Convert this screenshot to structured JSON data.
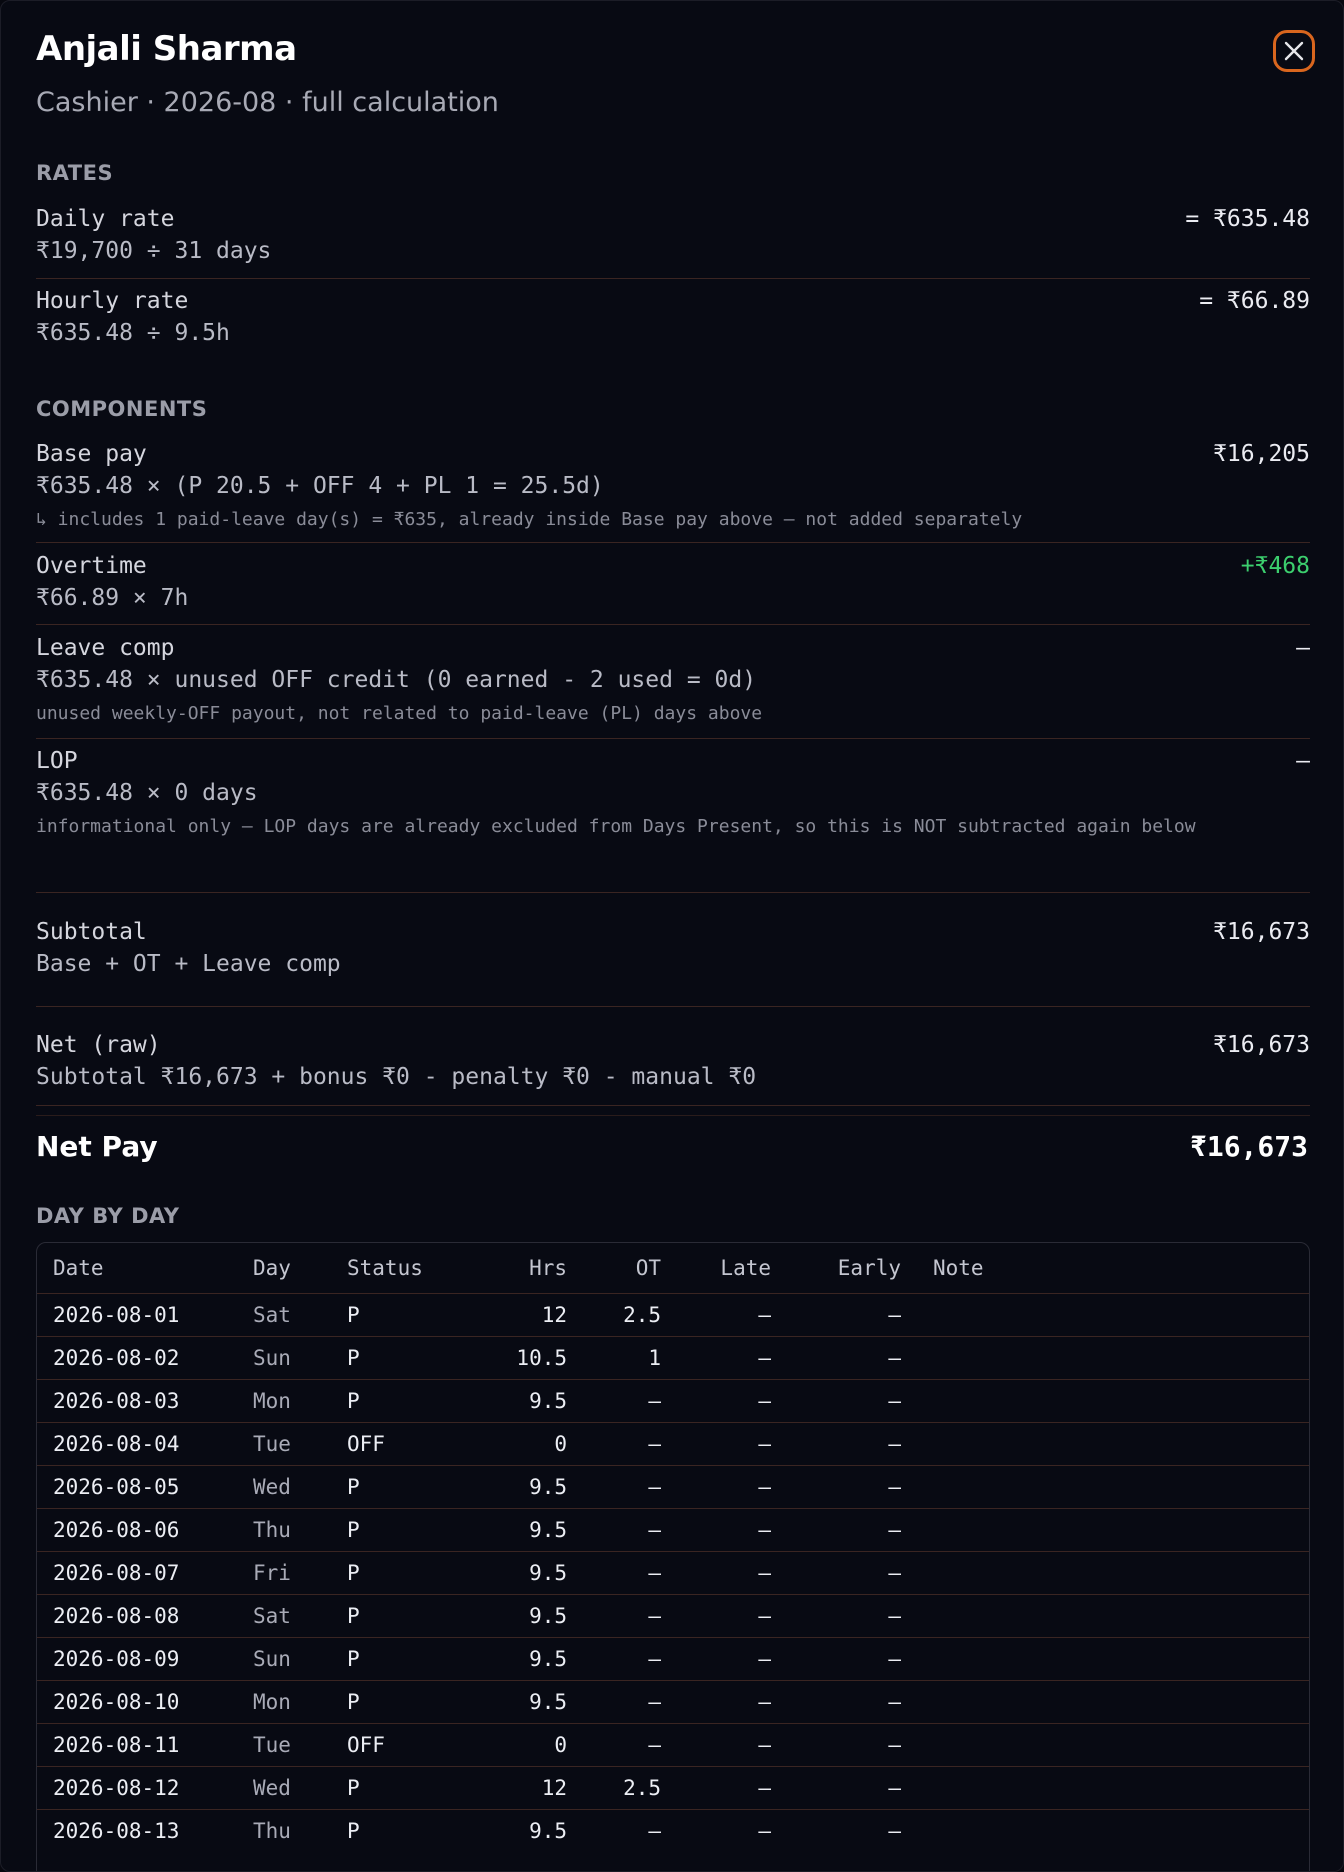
{
  "header": {
    "name": "Anjali Sharma",
    "subtitle": "Cashier · 2026-08 · full calculation"
  },
  "rates": {
    "heading": "RATES",
    "daily": {
      "label": "Daily rate",
      "formula": "₹19,700 ÷ 31 days",
      "value": "= ₹635.48"
    },
    "hourly": {
      "label": "Hourly rate",
      "formula": "₹635.48 ÷ 9.5h",
      "value": "= ₹66.89"
    }
  },
  "components": {
    "heading": "COMPONENTS",
    "base": {
      "label": "Base pay",
      "formula": "₹635.48 × (P 20.5 + OFF 4 + PL 1 = 25.5d)",
      "note": "↳ includes 1 paid-leave day(s) = ₹635, already inside Base pay above — not added separately",
      "value": "₹16,205"
    },
    "overtime": {
      "label": "Overtime",
      "formula": "₹66.89 × 7h",
      "value": "+₹468",
      "value_color": "#3ccf6e"
    },
    "leave_comp": {
      "label": "Leave comp",
      "formula": "₹635.48 × unused OFF credit (0 earned - 2 used = 0d)",
      "note": "unused weekly-OFF payout, not related to paid-leave (PL) days above",
      "value": "—"
    },
    "lop": {
      "label": "LOP",
      "formula": "₹635.48 × 0 days",
      "note": "informational only — LOP days are already excluded from Days Present, so this is NOT subtracted again below",
      "value": "—"
    }
  },
  "subtotal": {
    "label": "Subtotal",
    "formula": "Base + OT + Leave comp",
    "value": "₹16,673"
  },
  "net_raw": {
    "label": "Net (raw)",
    "formula": "Subtotal ₹16,673 + bonus ₹0 - penalty ₹0 - manual ₹0",
    "value": "₹16,673"
  },
  "net_pay": {
    "label": "Net Pay",
    "value": "₹16,673"
  },
  "day_by_day": {
    "heading": "DAY BY DAY",
    "columns": [
      "Date",
      "Day",
      "Status",
      "Hrs",
      "OT",
      "Late",
      "Early",
      "Note"
    ],
    "rows": [
      [
        "2026-08-01",
        "Sat",
        "P",
        "12",
        "2.5",
        "—",
        "—",
        ""
      ],
      [
        "2026-08-02",
        "Sun",
        "P",
        "10.5",
        "1",
        "—",
        "—",
        ""
      ],
      [
        "2026-08-03",
        "Mon",
        "P",
        "9.5",
        "—",
        "—",
        "—",
        ""
      ],
      [
        "2026-08-04",
        "Tue",
        "OFF",
        "0",
        "—",
        "—",
        "—",
        ""
      ],
      [
        "2026-08-05",
        "Wed",
        "P",
        "9.5",
        "—",
        "—",
        "—",
        ""
      ],
      [
        "2026-08-06",
        "Thu",
        "P",
        "9.5",
        "—",
        "—",
        "—",
        ""
      ],
      [
        "2026-08-07",
        "Fri",
        "P",
        "9.5",
        "—",
        "—",
        "—",
        ""
      ],
      [
        "2026-08-08",
        "Sat",
        "P",
        "9.5",
        "—",
        "—",
        "—",
        ""
      ],
      [
        "2026-08-09",
        "Sun",
        "P",
        "9.5",
        "—",
        "—",
        "—",
        ""
      ],
      [
        "2026-08-10",
        "Mon",
        "P",
        "9.5",
        "—",
        "—",
        "—",
        ""
      ],
      [
        "2026-08-11",
        "Tue",
        "OFF",
        "0",
        "—",
        "—",
        "—",
        ""
      ],
      [
        "2026-08-12",
        "Wed",
        "P",
        "12",
        "2.5",
        "—",
        "—",
        ""
      ],
      [
        "2026-08-13",
        "Thu",
        "P",
        "9.5",
        "—",
        "—",
        "—",
        ""
      ]
    ]
  }
}
